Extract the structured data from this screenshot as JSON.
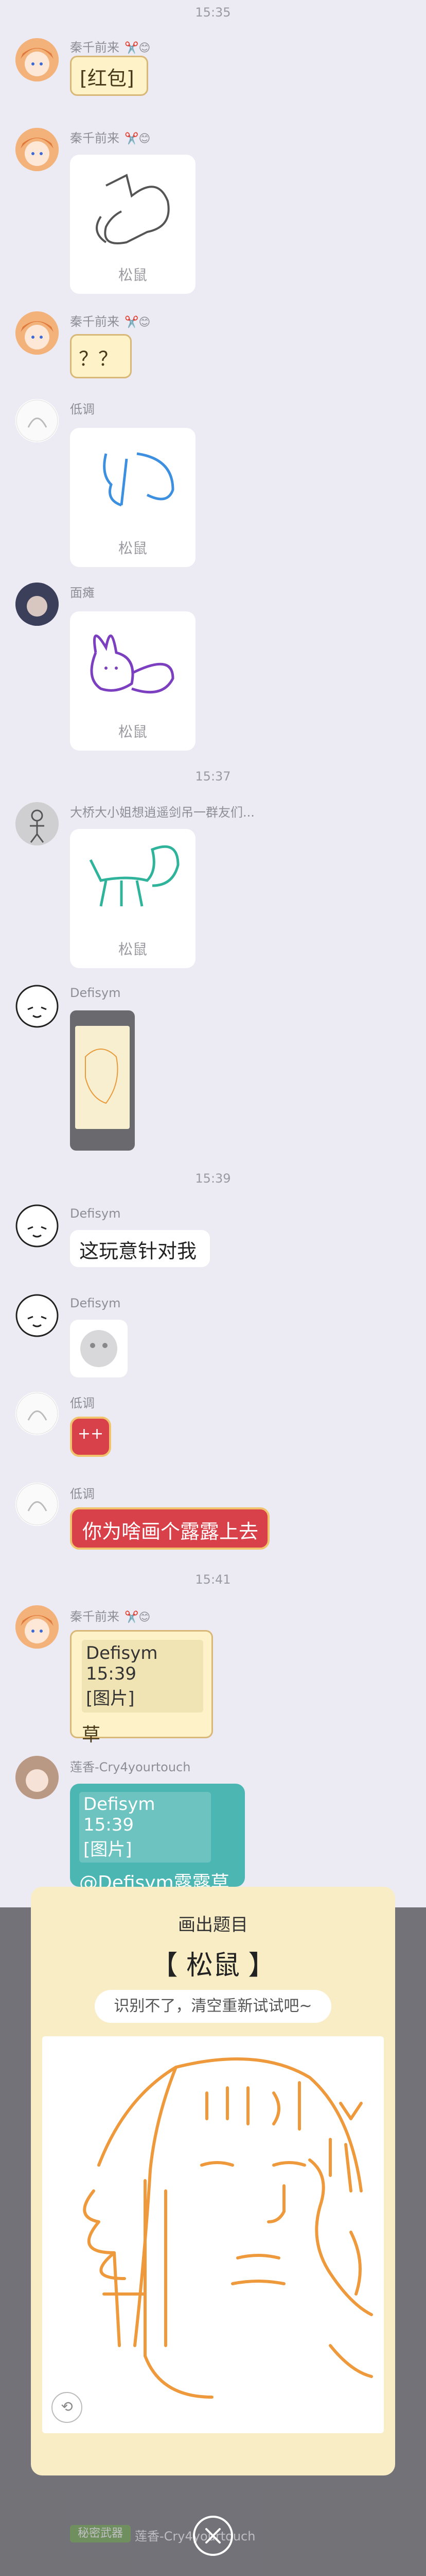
{
  "times": [
    "15:35",
    "15:37",
    "15:39",
    "15:41"
  ],
  "users": {
    "qq": "秦千前来",
    "didiao": "低调",
    "miantan": "面瘫",
    "daqiao": "大桥大小姐想逍遥剑吊一群友们...",
    "defisym": "Defisym",
    "lianxiang": "莲香-Cry4yourtouch"
  },
  "messages": {
    "hongbao": "[红包]",
    "question": "？？",
    "squirrel_caption": "松鼠",
    "wanyi": "这玩意针对我",
    "emoji_plus": "++",
    "why_draw": "你为啥画个露露上去",
    "reply1_header": "Defisym 15:39",
    "reply1_image": "[图片]",
    "reply1_body": "草",
    "reply2_header": "Defisym 15:39",
    "reply2_image": "[图片]",
    "reply2_body": "@Defisym露露草"
  },
  "modal": {
    "title": "画出题目",
    "subject": "【 松鼠 】",
    "hint": "识别不了，清空重新试试吧~"
  },
  "bottom_partial": {
    "tag": "秘密武器",
    "name": "莲香-Cry4yourtouch"
  },
  "colors": {
    "background": "#ecebf4",
    "yellow_bubble": "#fdf2c8",
    "teal_bubble": "#4cb6b2",
    "red_bubble": "#d8414a",
    "drawing_orange": "#ee9a3c"
  }
}
